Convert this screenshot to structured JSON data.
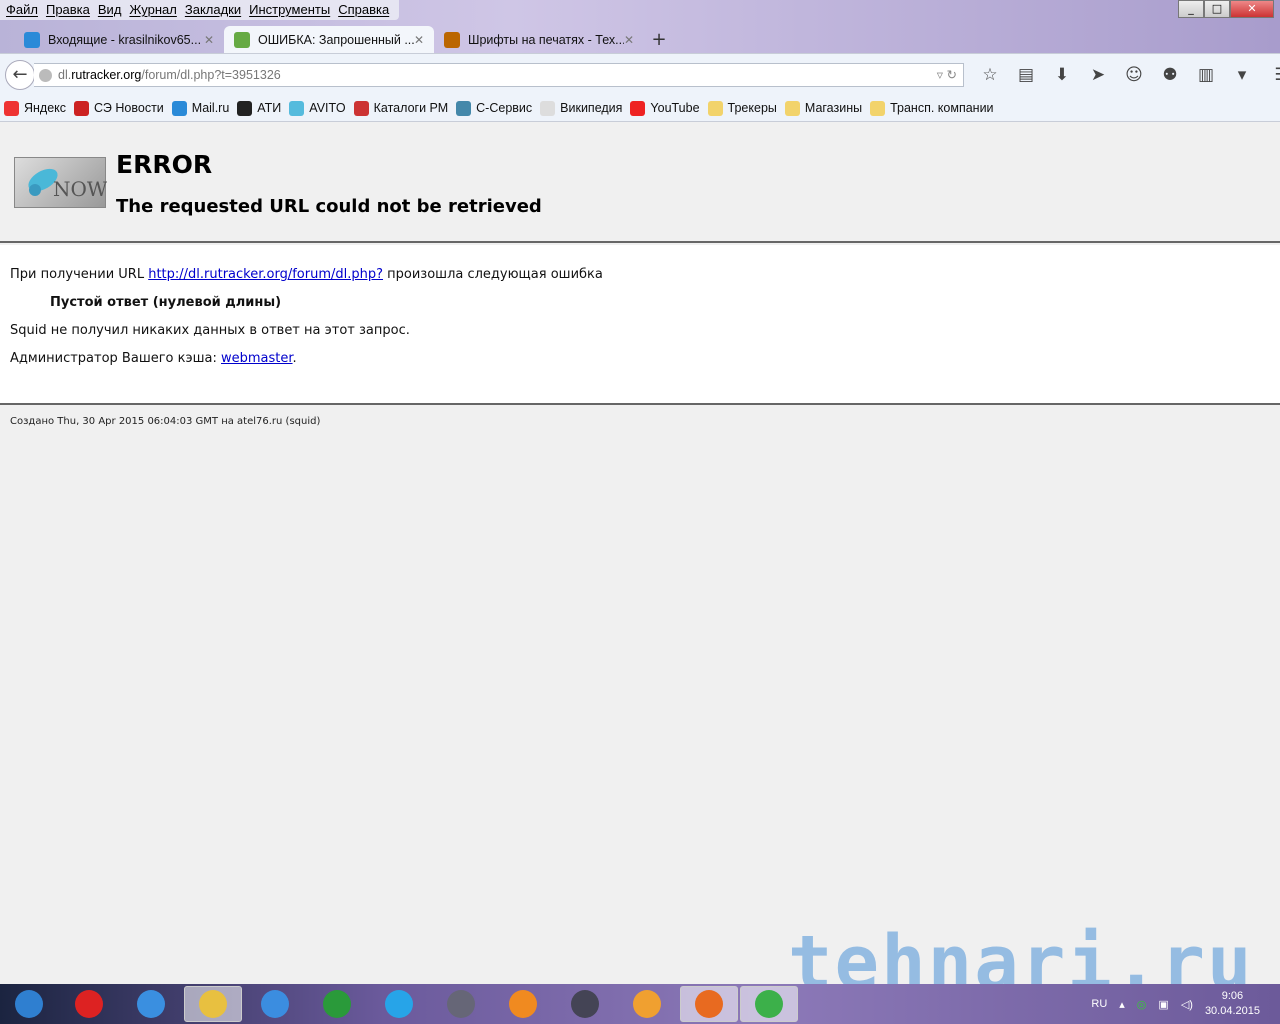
{
  "menu": [
    "Файл",
    "Правка",
    "Вид",
    "Журнал",
    "Закладки",
    "Инструменты",
    "Справка"
  ],
  "tabs": [
    {
      "title": "Входящие - krasilnikov65...",
      "color": "#2a8ad8"
    },
    {
      "title": "ОШИБКА: Запрошенный ...",
      "color": "#6a4"
    },
    {
      "title": "Шрифты на печатях - Тех...",
      "color": "#b60"
    }
  ],
  "url": {
    "prefix": "dl.",
    "domain": "rutracker.org",
    "path": "/forum/dl.php?t=3951326"
  },
  "bookmarks": [
    {
      "label": "Яндекс",
      "color": "#e33"
    },
    {
      "label": "СЭ Новости",
      "color": "#c22"
    },
    {
      "label": "Mail.ru",
      "color": "#2a8ad8"
    },
    {
      "label": "АТИ",
      "color": "#222"
    },
    {
      "label": "AVITO",
      "color": "#5bd"
    },
    {
      "label": "Каталоги РМ",
      "color": "#c33"
    },
    {
      "label": "С-Сервис",
      "color": "#48a"
    },
    {
      "label": "Википедия",
      "color": "#ddd"
    },
    {
      "label": "YouTube",
      "color": "#e22"
    },
    {
      "label": "Трекеры",
      "color": "#f2d36b"
    },
    {
      "label": "Магазины",
      "color": "#f2d36b"
    },
    {
      "label": "Трансп. компании",
      "color": "#f2d36b"
    }
  ],
  "page": {
    "title": "ERROR",
    "subtitle": "The requested URL could not be retrieved",
    "line1_pre": "При получении URL ",
    "line1_link": "http://dl.rutracker.org/forum/dl.php?",
    "line1_post": " произошла следующая ошибка",
    "error": "Пустой ответ (нулевой длины)",
    "line2": "Squid не получил никаких данных в ответ на этот запрос.",
    "line3_pre": "Администратор Вашего кэша: ",
    "line3_link": "webmaster",
    "line3_post": ".",
    "footer": "Создано Thu, 30 Apr 2015 06:04:03 GMT на atel76.ru (squid)"
  },
  "logo_text": "NOW",
  "watermark": "tehnari.ru",
  "taskbar": {
    "apps": [
      "#2f7fd0",
      "#d22",
      "#3a8fe0",
      "#e8c040",
      "#3b8de0",
      "#2a9a3a",
      "#27a4e8",
      "#667",
      "#f08a20",
      "#445",
      "#f0a030",
      "#e86a20",
      "#3cb04a"
    ],
    "lang": "RU",
    "time": "9:06",
    "date": "30.04.2015"
  }
}
